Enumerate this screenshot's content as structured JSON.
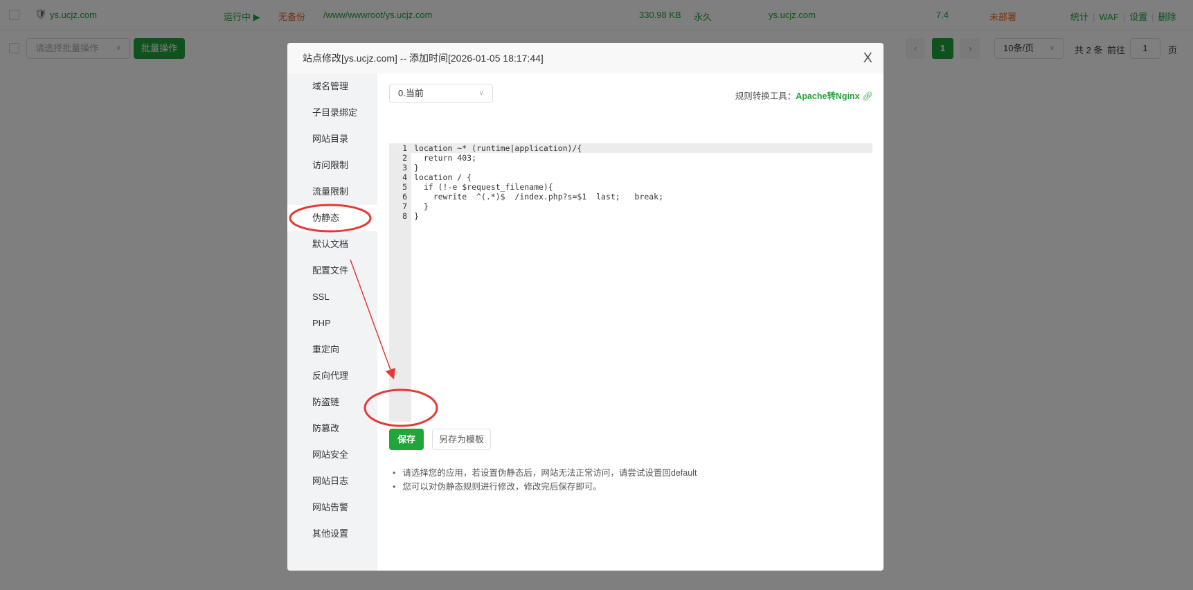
{
  "site_row": {
    "domain": "ys.ucjz.com",
    "status": "运行中 ▶",
    "backup": "无备份",
    "path": "/www/wwwroot/ys.ucjz.com",
    "size": "330.98 KB",
    "expiry": "永久",
    "remark": "ys.ucjz.com",
    "php": "7.4",
    "ssl": "未部署",
    "ops": [
      "统计",
      "WAF",
      "设置",
      "删除"
    ]
  },
  "batch": {
    "placeholder": "请选择批量操作",
    "button": "批量操作"
  },
  "pagination": {
    "current": "1",
    "page_size": "10条/页",
    "total": "共 2 条",
    "goto": "前往",
    "goto_value": "1",
    "page_unit": "页"
  },
  "modal": {
    "title": "站点修改[ys.ucjz.com] -- 添加时间[2026-01-05 18:17:44]",
    "close": "X",
    "sidebar": [
      "域名管理",
      "子目录绑定",
      "网站目录",
      "访问限制",
      "流量限制",
      "伪静态",
      "默认文档",
      "配置文件",
      "SSL",
      "PHP",
      "重定向",
      "反向代理",
      "防盗链",
      "防篡改",
      "网站安全",
      "网站日志",
      "网站告警",
      "其他设置"
    ],
    "active_index": 5,
    "template_select": "0.当前",
    "tool_label": "规则转换工具：",
    "tool_link": "Apache转Nginx",
    "code_lines": [
      "location ~* (runtime|application)/{",
      "  return 403;",
      "}",
      "location / {",
      "  if (!-e $request_filename){",
      "    rewrite  ^(.*)$  /index.php?s=$1  last;   break;",
      "  }",
      "}"
    ],
    "save": "保存",
    "save_template": "另存为模板",
    "notes": [
      "请选择您的应用，若设置伪静态后，网站无法正常访问，请尝试设置回default",
      "您可以对伪静态规则进行修改，修改完后保存即可。"
    ]
  },
  "colors": {
    "accent": "#20a53a",
    "warning": "#f0641e",
    "annotation": "#e53935"
  }
}
